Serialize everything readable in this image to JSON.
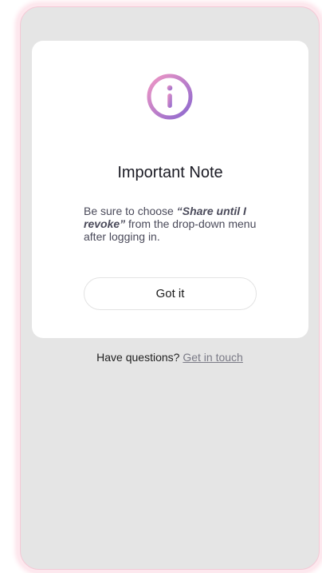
{
  "dialog": {
    "icon": "info-icon",
    "title": "Important Note",
    "message_prefix": "Be sure to choose ",
    "message_emphasis": "“Share until I revoke”",
    "message_suffix": " from the drop-down menu after logging in.",
    "button_label": "Got it"
  },
  "footer": {
    "question": "Have questions?",
    "link_label": "Get in touch"
  },
  "colors": {
    "screen_background": "#e5e5e5",
    "card_background": "#ffffff",
    "icon_gradient_start": "#e58ab8",
    "icon_gradient_end": "#8d6bd1"
  }
}
